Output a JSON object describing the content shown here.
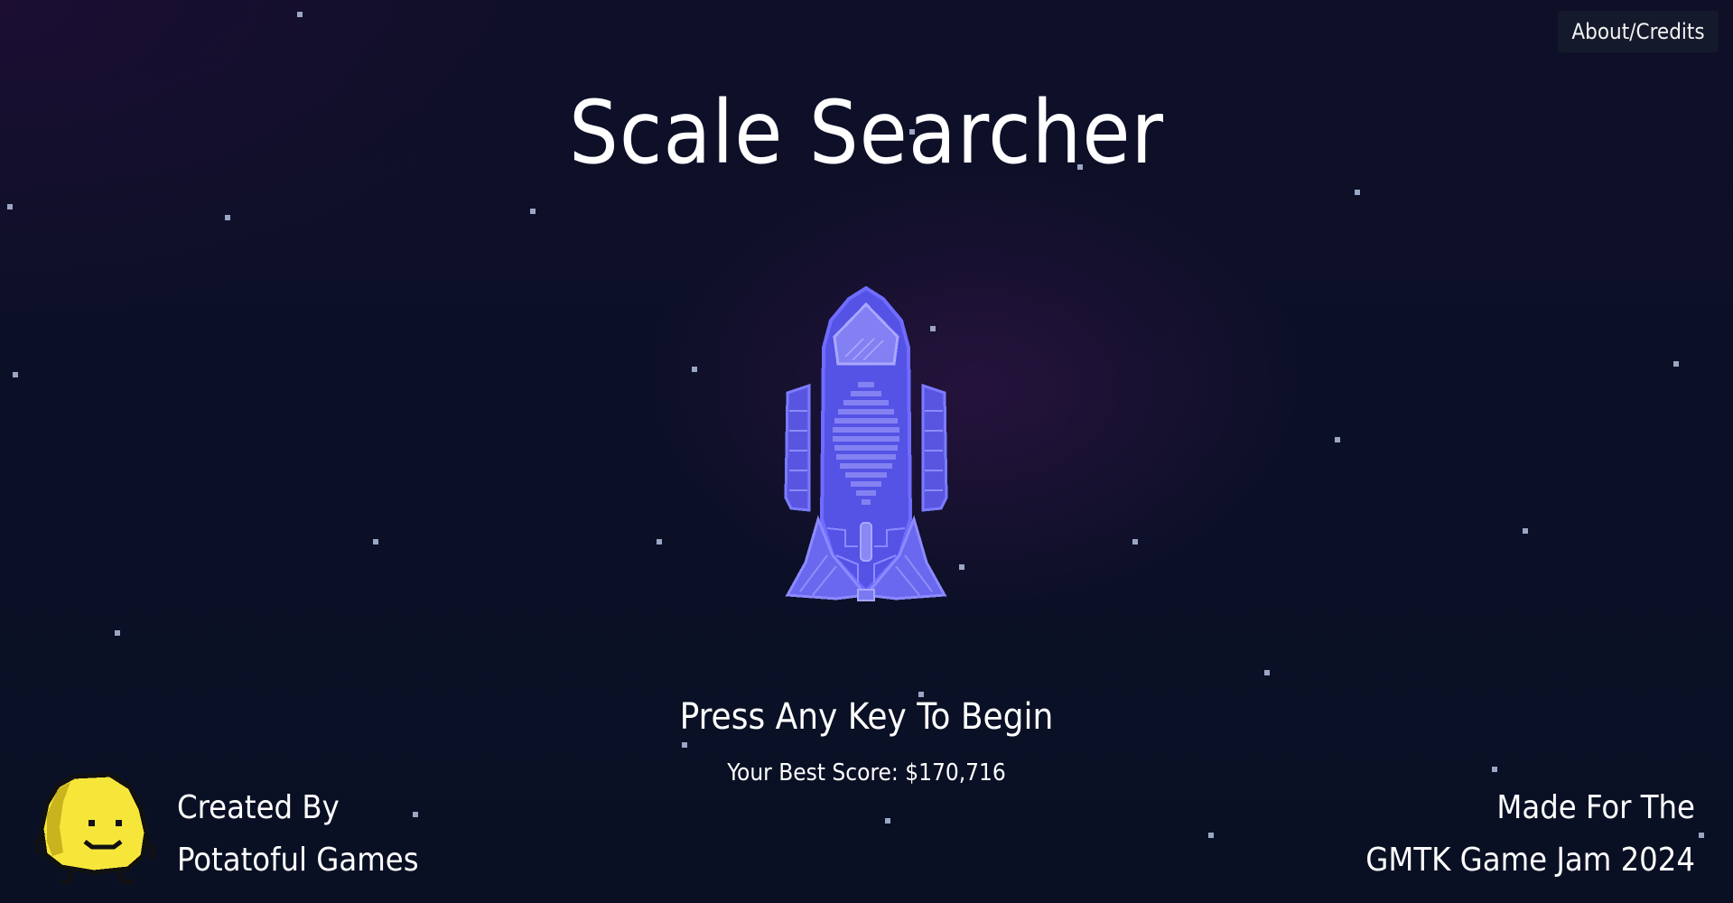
{
  "header": {
    "about_label": "About/Credits"
  },
  "title": "Scale Searcher",
  "ship": {
    "icon": "rocket-ship-icon",
    "color": "#5a5ae6"
  },
  "prompt": "Press Any Key To Begin",
  "best_score": "Your Best Score: $170,716",
  "credits_left": {
    "mascot_icon": "potato-mascot-icon",
    "line1": "Created By",
    "line2": "Potatoful Games"
  },
  "credits_right": {
    "line1": "Made For The",
    "line2": "GMTK Game Jam 2024"
  },
  "colors": {
    "background": "#0b1026",
    "star": "#9aa6c4",
    "text": "#ffffff",
    "button_bg": "#141a2b",
    "mascot": "#f7e63a"
  }
}
